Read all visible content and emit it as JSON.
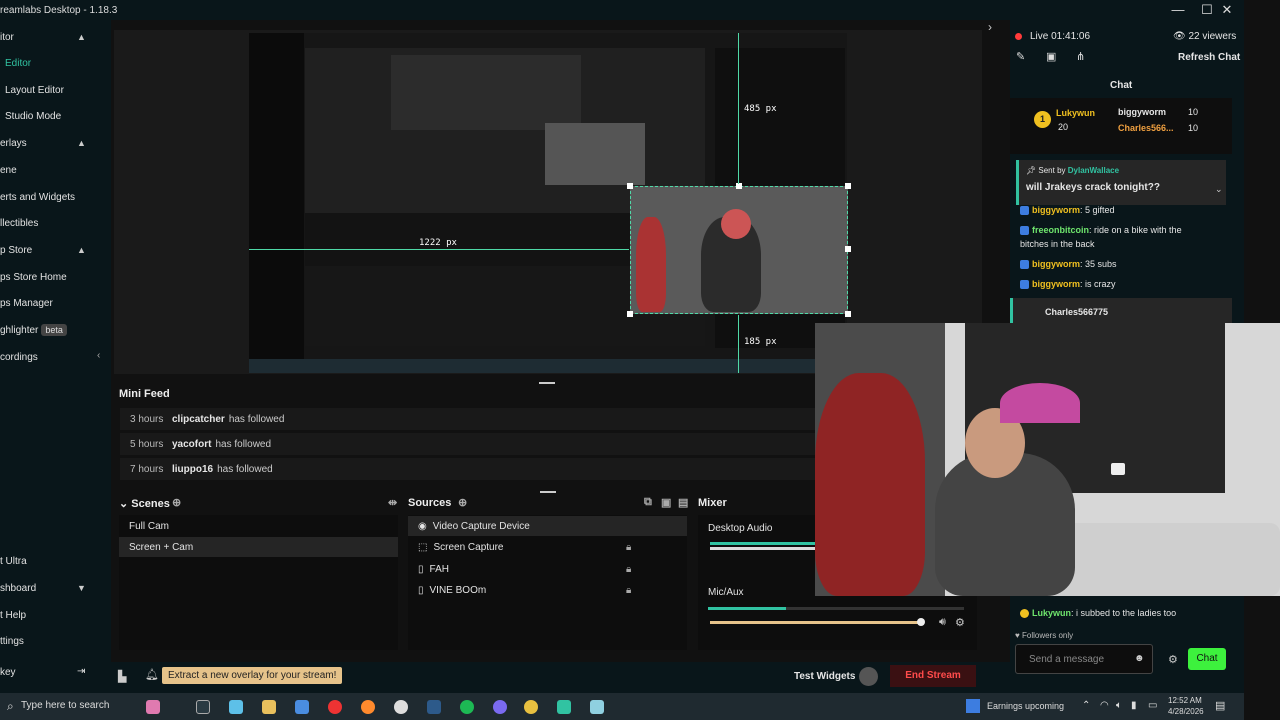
{
  "titlebar": {
    "title": "reamlabs Desktop - 1.18.3"
  },
  "sidebar": {
    "items": [
      {
        "label": "itor"
      },
      {
        "label": "Editor"
      },
      {
        "label": "Layout Editor"
      },
      {
        "label": "Studio Mode"
      },
      {
        "label": "erlays"
      },
      {
        "label": "ene"
      },
      {
        "label": "erts and Widgets"
      },
      {
        "label": "llectibles"
      },
      {
        "label": "p Store"
      },
      {
        "label": "ps Store Home"
      },
      {
        "label": "ps Manager"
      },
      {
        "label": "ghlighter"
      },
      {
        "label": "cordings"
      }
    ],
    "beta": "beta",
    "bottom_items": [
      {
        "label": "t Ultra"
      },
      {
        "label": "shboard"
      },
      {
        "label": "t Help"
      },
      {
        "label": "ttings"
      },
      {
        "label": "key"
      }
    ]
  },
  "preview": {
    "guide_width": "1222 px",
    "guide_height": "485 px",
    "guide_small": "185 px"
  },
  "minifeed": {
    "title": "Mini Feed",
    "rows": [
      {
        "time": "3 hours",
        "user": "clipcatcher",
        "action": "has followed"
      },
      {
        "time": "5 hours",
        "user": "yacofort",
        "action": "has followed"
      },
      {
        "time": "7 hours",
        "user": "liuppo16",
        "action": "has followed"
      }
    ]
  },
  "scenes": {
    "title": "Scenes",
    "items": [
      "Full Cam",
      "Screen + Cam"
    ]
  },
  "sources": {
    "title": "Sources",
    "items": [
      "Video Capture Device",
      "Screen Capture",
      "FAH",
      "VINE BOOm"
    ]
  },
  "mixer": {
    "title": "Mixer",
    "items": [
      {
        "label": "Desktop Audio"
      },
      {
        "label": "Mic/Aux"
      }
    ]
  },
  "bottombar": {
    "tip": "Extract a new overlay for your stream!",
    "test_widgets": "Test Widgets",
    "end_stream": "End Stream"
  },
  "chat": {
    "live": "Live 01:41:06",
    "viewers": "22 viewers",
    "refresh": "Refresh Chat",
    "title": "Chat",
    "top": {
      "rank1_name": "Lukywun",
      "rank1_count": "20",
      "rank2_name": "biggyworm",
      "rank2_count": "10",
      "rank3_name": "Charles566...",
      "rank3_count": "10"
    },
    "pinned": {
      "sent_by": "Sent by",
      "user": "DylanWallace",
      "message": "will Jrakeys crack tonight??"
    },
    "messages": [
      {
        "user": "biggyworm",
        "text": ": 5 gifted"
      },
      {
        "user": "freeonbitcoin",
        "text": ": ride on a bike with the"
      },
      {
        "user": "",
        "text": "bitches in the back"
      },
      {
        "user": "biggyworm",
        "text": ": 35 subs"
      },
      {
        "user": "biggyworm",
        "text": ": is crazy"
      }
    ],
    "highlight_user": "Charles566775",
    "last": {
      "user": "Lukywun",
      "text": ": i subbed to the ladies too"
    },
    "followers_only": "Followers only",
    "placeholder": "Send a message",
    "send": "Chat"
  },
  "taskbar": {
    "search": "Type here to search",
    "news": "Earnings upcoming",
    "time": "12:52 AM",
    "date": "4/28/2026"
  },
  "colors": {
    "accent": "#31c3a2",
    "live": "#ff3b3b",
    "chat_btn": "#3df13d",
    "end_stream": "#ff3b3b"
  }
}
